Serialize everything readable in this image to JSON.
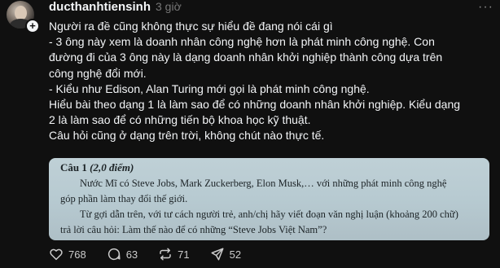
{
  "post": {
    "username": "ducthanhtiensinh",
    "time": "3 giờ",
    "lines": [
      "Người ra đề cũng không thực sự hiểu đề đang nói cái gì",
      "- 3 ông này xem là doanh nhân công nghệ hơn là phát minh công nghệ. Con",
      "đường đi của 3 ông này là dạng doanh nhân khởi nghiệp thành công dựa trên",
      "công nghệ đổi mới.",
      "- Kiểu như Edison, Alan Turing mới gọi là phát minh công nghệ.",
      "Hiểu bài theo dạng 1 là làm sao để có những doanh nhân khởi nghiệp. Kiểu dạng",
      "2 là làm sao để có những tiến bộ khoa học kỹ thuật.",
      "Câu hỏi cũng ở dạng trên trời, không chút nào thực tế."
    ]
  },
  "exam": {
    "question_label": "Câu 1",
    "score": "(2,0 điểm)",
    "lines": [
      "Nước Mĩ có Steve Jobs, Mark Zuckerberg, Elon Musk,… với những phát minh công nghệ",
      "góp phần làm thay đổi thế giới.",
      "Từ gợi dẫn trên, với tư cách người trẻ, anh/chị hãy viết đoạn văn nghị luận (khoảng 200 chữ)",
      "trả lời câu hỏi: Làm thế nào để có những “Steve Jobs Việt Nam”?"
    ]
  },
  "actions": {
    "likes": "768",
    "comments": "63",
    "reposts": "71",
    "shares": "52"
  },
  "icons": {
    "more": "more-icon",
    "like": "heart-icon",
    "comment": "comment-icon",
    "repost": "repost-icon",
    "share": "share-icon",
    "follow": "plus-icon"
  }
}
